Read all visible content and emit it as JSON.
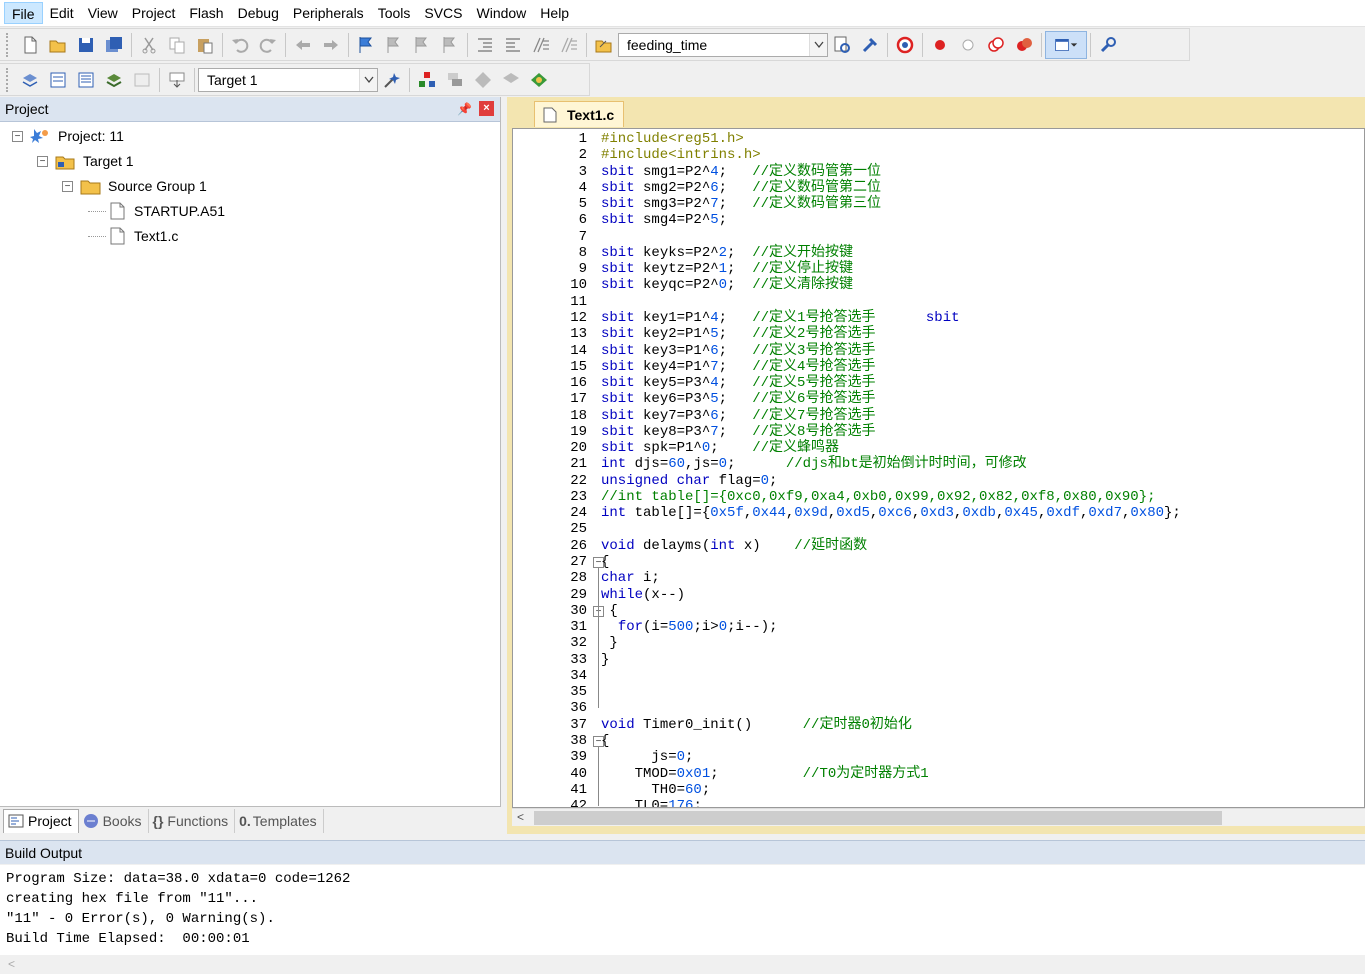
{
  "menu": [
    "File",
    "Edit",
    "View",
    "Project",
    "Flash",
    "Debug",
    "Peripherals",
    "Tools",
    "SVCS",
    "Window",
    "Help"
  ],
  "toolbar": {
    "find_combo": "feeding_time",
    "target_combo": "Target 1"
  },
  "project_pane": {
    "title": "Project",
    "tree": [
      {
        "label": "Project: 11",
        "level": 0,
        "toggle": "−",
        "icon": "project-icon"
      },
      {
        "label": "Target 1",
        "level": 1,
        "toggle": "−",
        "icon": "target-icon"
      },
      {
        "label": "Source Group 1",
        "level": 2,
        "toggle": "−",
        "icon": "folder-icon"
      },
      {
        "label": "STARTUP.A51",
        "level": 3,
        "toggle": "",
        "icon": "file-icon"
      },
      {
        "label": "Text1.c",
        "level": 3,
        "toggle": "",
        "icon": "file-icon"
      }
    ],
    "tabs": [
      "Project",
      "Books",
      "Functions",
      "Templates"
    ]
  },
  "editor": {
    "tab": "Text1.c",
    "lines": [
      [
        [
          "pp",
          "#include<reg51.h>"
        ]
      ],
      [
        [
          "pp",
          "#include<intrins.h>"
        ]
      ],
      [
        [
          "kw",
          "sbit"
        ],
        [
          "t",
          " smg1=P2^"
        ],
        [
          "nm",
          "4"
        ],
        [
          "t",
          ";   "
        ],
        [
          "cm",
          "//定义数码管第一位"
        ]
      ],
      [
        [
          "kw",
          "sbit"
        ],
        [
          "t",
          " smg2=P2^"
        ],
        [
          "nm",
          "6"
        ],
        [
          "t",
          ";   "
        ],
        [
          "cm",
          "//定义数码管第二位"
        ]
      ],
      [
        [
          "kw",
          "sbit"
        ],
        [
          "t",
          " smg3=P2^"
        ],
        [
          "nm",
          "7"
        ],
        [
          "t",
          ";   "
        ],
        [
          "cm",
          "//定义数码管第三位"
        ]
      ],
      [
        [
          "kw",
          "sbit"
        ],
        [
          "t",
          " smg4=P2^"
        ],
        [
          "nm",
          "5"
        ],
        [
          "t",
          ";"
        ]
      ],
      [],
      [
        [
          "kw",
          "sbit"
        ],
        [
          "t",
          " keyks=P2^"
        ],
        [
          "nm",
          "2"
        ],
        [
          "t",
          ";  "
        ],
        [
          "cm",
          "//定义开始按键"
        ]
      ],
      [
        [
          "kw",
          "sbit"
        ],
        [
          "t",
          " keytz=P2^"
        ],
        [
          "nm",
          "1"
        ],
        [
          "t",
          ";  "
        ],
        [
          "cm",
          "//定义停止按键"
        ]
      ],
      [
        [
          "kw",
          "sbit"
        ],
        [
          "t",
          " keyqc=P2^"
        ],
        [
          "nm",
          "0"
        ],
        [
          "t",
          ";  "
        ],
        [
          "cm",
          "//定义清除按键"
        ]
      ],
      [],
      [
        [
          "kw",
          "sbit"
        ],
        [
          "t",
          " key1=P1^"
        ],
        [
          "nm",
          "4"
        ],
        [
          "t",
          ";   "
        ],
        [
          "cm",
          "//定义1号抢答选手"
        ],
        [
          "t",
          "      "
        ],
        [
          "kw",
          "sbit"
        ]
      ],
      [
        [
          "kw",
          "sbit"
        ],
        [
          "t",
          " key2=P1^"
        ],
        [
          "nm",
          "5"
        ],
        [
          "t",
          ";   "
        ],
        [
          "cm",
          "//定义2号抢答选手"
        ]
      ],
      [
        [
          "kw",
          "sbit"
        ],
        [
          "t",
          " key3=P1^"
        ],
        [
          "nm",
          "6"
        ],
        [
          "t",
          ";   "
        ],
        [
          "cm",
          "//定义3号抢答选手"
        ]
      ],
      [
        [
          "kw",
          "sbit"
        ],
        [
          "t",
          " key4=P1^"
        ],
        [
          "nm",
          "7"
        ],
        [
          "t",
          ";   "
        ],
        [
          "cm",
          "//定义4号抢答选手"
        ]
      ],
      [
        [
          "kw",
          "sbit"
        ],
        [
          "t",
          " key5=P3^"
        ],
        [
          "nm",
          "4"
        ],
        [
          "t",
          ";   "
        ],
        [
          "cm",
          "//定义5号抢答选手"
        ]
      ],
      [
        [
          "kw",
          "sbit"
        ],
        [
          "t",
          " key6=P3^"
        ],
        [
          "nm",
          "5"
        ],
        [
          "t",
          ";   "
        ],
        [
          "cm",
          "//定义6号抢答选手"
        ]
      ],
      [
        [
          "kw",
          "sbit"
        ],
        [
          "t",
          " key7=P3^"
        ],
        [
          "nm",
          "6"
        ],
        [
          "t",
          ";   "
        ],
        [
          "cm",
          "//定义7号抢答选手"
        ]
      ],
      [
        [
          "kw",
          "sbit"
        ],
        [
          "t",
          " key8=P3^"
        ],
        [
          "nm",
          "7"
        ],
        [
          "t",
          ";   "
        ],
        [
          "cm",
          "//定义8号抢答选手"
        ]
      ],
      [
        [
          "kw",
          "sbit"
        ],
        [
          "t",
          " spk=P1^"
        ],
        [
          "nm",
          "0"
        ],
        [
          "t",
          ";    "
        ],
        [
          "cm",
          "//定义蜂鸣器"
        ]
      ],
      [
        [
          "kw",
          "int"
        ],
        [
          "t",
          " djs="
        ],
        [
          "nm",
          "60"
        ],
        [
          "t",
          ",js="
        ],
        [
          "nm",
          "0"
        ],
        [
          "t",
          ";      "
        ],
        [
          "cm",
          "//djs和bt是初始倒计时时间，可修改"
        ]
      ],
      [
        [
          "kw",
          "unsigned char"
        ],
        [
          "t",
          " flag="
        ],
        [
          "nm",
          "0"
        ],
        [
          "t",
          ";"
        ]
      ],
      [
        [
          "cm",
          "//int table[]={0xc0,0xf9,0xa4,0xb0,0x99,0x92,0x82,0xf8,0x80,0x90};"
        ]
      ],
      [
        [
          "kw",
          "int"
        ],
        [
          "t",
          " table[]={"
        ],
        [
          "nm",
          "0x5f"
        ],
        [
          "t",
          ","
        ],
        [
          "nm",
          "0x44"
        ],
        [
          "t",
          ","
        ],
        [
          "nm",
          "0x9d"
        ],
        [
          "t",
          ","
        ],
        [
          "nm",
          "0xd5"
        ],
        [
          "t",
          ","
        ],
        [
          "nm",
          "0xc6"
        ],
        [
          "t",
          ","
        ],
        [
          "nm",
          "0xd3"
        ],
        [
          "t",
          ","
        ],
        [
          "nm",
          "0xdb"
        ],
        [
          "t",
          ","
        ],
        [
          "nm",
          "0x45"
        ],
        [
          "t",
          ","
        ],
        [
          "nm",
          "0xdf"
        ],
        [
          "t",
          ","
        ],
        [
          "nm",
          "0xd7"
        ],
        [
          "t",
          ","
        ],
        [
          "nm",
          "0x80"
        ],
        [
          "t",
          "};"
        ]
      ],
      [],
      [
        [
          "kw",
          "void"
        ],
        [
          "t",
          " delayms("
        ],
        [
          "kw",
          "int"
        ],
        [
          "t",
          " x)    "
        ],
        [
          "cm",
          "//延时函数"
        ]
      ],
      [
        [
          "t",
          "{"
        ]
      ],
      [
        [
          "kw",
          "char"
        ],
        [
          "t",
          " i;"
        ]
      ],
      [
        [
          "kw",
          "while"
        ],
        [
          "t",
          "(x--)"
        ]
      ],
      [
        [
          "t",
          " {"
        ]
      ],
      [
        [
          "t",
          "  "
        ],
        [
          "kw",
          "for"
        ],
        [
          "t",
          "(i="
        ],
        [
          "nm",
          "500"
        ],
        [
          "t",
          ";i>"
        ],
        [
          "nm",
          "0"
        ],
        [
          "t",
          ";i--);"
        ]
      ],
      [
        [
          "t",
          " }"
        ]
      ],
      [
        [
          "t",
          "}"
        ]
      ],
      [],
      [],
      [],
      [
        [
          "kw",
          "void"
        ],
        [
          "t",
          " Timer0_init()      "
        ],
        [
          "cm",
          "//定时器0初始化"
        ]
      ],
      [
        [
          "t",
          "{"
        ]
      ],
      [
        [
          "t",
          "      js="
        ],
        [
          "nm",
          "0"
        ],
        [
          "t",
          ";"
        ]
      ],
      [
        [
          "t",
          "    TMOD="
        ],
        [
          "nm",
          "0x01"
        ],
        [
          "t",
          ";          "
        ],
        [
          "cm",
          "//T0为定时器方式1"
        ]
      ],
      [
        [
          "t",
          "      TH0="
        ],
        [
          "nm",
          "60"
        ],
        [
          "t",
          ";"
        ]
      ],
      [
        [
          "t",
          "    TL0="
        ],
        [
          "nm",
          "176"
        ],
        [
          "t",
          ";"
        ]
      ]
    ]
  },
  "build_output": {
    "title": "Build Output",
    "lines": [
      "Program Size: data=38.0 xdata=0 code=1262",
      "creating hex file from \"11\"...",
      "\"11\" - 0 Error(s), 0 Warning(s).",
      "Build Time Elapsed:  00:00:01"
    ]
  }
}
